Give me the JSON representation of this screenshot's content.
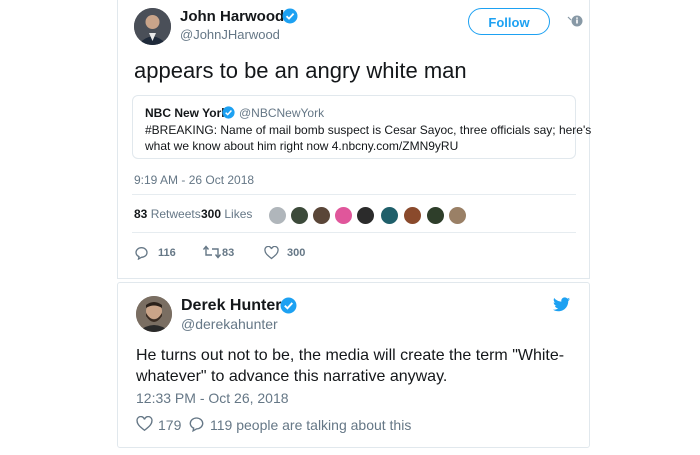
{
  "tweet1": {
    "author_name": "John Harwood",
    "author_handle": "@JohnJHarwood",
    "follow_label": "Follow",
    "text": "appears to be an angry white man",
    "quote": {
      "author_name": "NBC New York",
      "author_handle": "@NBCNewYork",
      "text_line1": "#BREAKING: Name of mail bomb suspect is Cesar Sayoc, three officials say; here's",
      "text_line2": "what we know about him right now 4.nbcny.com/ZMN9yRU"
    },
    "timestamp": "9:19 AM - 26 Oct 2018",
    "retweets_count": "83",
    "retweets_label": "Retweets",
    "likes_count": "300",
    "likes_label": "Likes",
    "actions": {
      "replies": "116",
      "retweets": "83",
      "likes": "300"
    },
    "colors": {
      "accent": "#1da1f2",
      "verified": "#1da1f2"
    }
  },
  "tweet2": {
    "author_name": "Derek Hunter",
    "author_handle": "@derekahunter",
    "text_line1": "He turns out not to be, the media will create the term \"White-",
    "text_line2": "whatever\" to advance this narrative anyway.",
    "timestamp": "12:33 PM - Oct 26, 2018",
    "likes": "179",
    "talking": "119 people are talking about this",
    "colors": {
      "twitter_bird": "#1da1f2"
    }
  }
}
